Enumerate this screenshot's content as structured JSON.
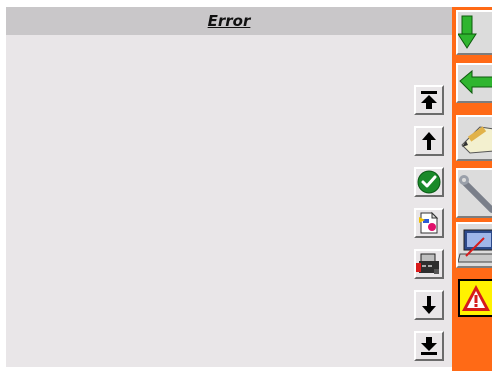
{
  "window": {
    "title": "Error"
  },
  "toolbar": {
    "buttons": [
      {
        "name": "scroll-top",
        "icon": "arrow-to-top-icon"
      },
      {
        "name": "scroll-up",
        "icon": "arrow-up-icon"
      },
      {
        "name": "confirm",
        "icon": "green-check-icon"
      },
      {
        "name": "export-document",
        "icon": "document-export-icon"
      },
      {
        "name": "print-device",
        "icon": "printer-icon"
      },
      {
        "name": "scroll-down",
        "icon": "arrow-down-icon"
      },
      {
        "name": "scroll-bottom",
        "icon": "arrow-to-bottom-icon"
      }
    ]
  },
  "sidebar": {
    "items": [
      {
        "name": "download",
        "icon": "green-arrow-down-icon"
      },
      {
        "name": "back",
        "icon": "green-arrow-left-icon"
      },
      {
        "name": "edit-notes",
        "icon": "pencil-note-icon"
      },
      {
        "name": "tools",
        "icon": "wrench-icon"
      },
      {
        "name": "computer",
        "icon": "laptop-icon"
      },
      {
        "name": "warning",
        "icon": "warning-triangle-icon"
      }
    ]
  },
  "colors": {
    "accent": "#ff6a16",
    "panel": "#e9e6e8",
    "title_bar": "#c9c7c9",
    "warning": "#fff200",
    "success": "#1a8a2a"
  }
}
